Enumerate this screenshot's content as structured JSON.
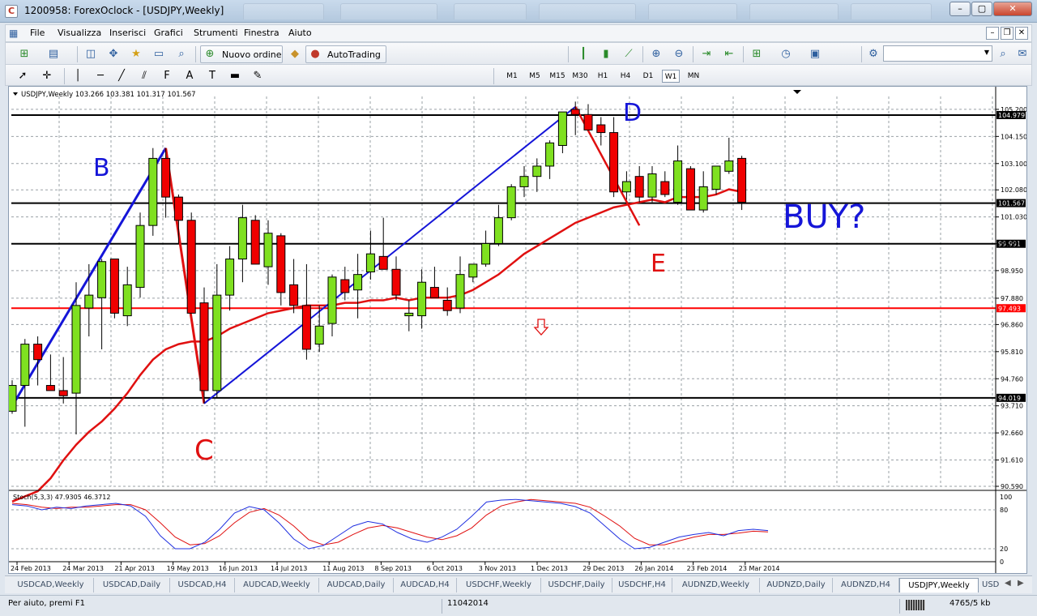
{
  "window": {
    "title": "1200958: ForexOclock - [USDJPY,Weekly]"
  },
  "menu": [
    "File",
    "Visualizza",
    "Inserisci",
    "Grafici",
    "Strumenti",
    "Finestra",
    "Aiuto"
  ],
  "toolbar": {
    "new_order_label": "Nuovo ordine",
    "autotrading_label": "AutoTrading",
    "search_value": ""
  },
  "timeframes": [
    "M1",
    "M5",
    "M15",
    "M30",
    "H1",
    "H4",
    "D1",
    "W1",
    "MN"
  ],
  "active_timeframe": "W1",
  "chart_data": {
    "type": "candlestick",
    "symbol_header": "USDJPY,Weekly  103.266 103.381 101.317 101.567",
    "y_range": [
      90.59,
      105.7
    ],
    "y_ticks": [
      "105.200",
      "104.150",
      "103.100",
      "102.080",
      "101.030",
      "99.991",
      "98.950",
      "97.880",
      "96.860",
      "95.810",
      "94.760",
      "93.710",
      "92.660",
      "91.610",
      "90.590"
    ],
    "x_labels": [
      "24 Feb 2013",
      "24 Mar 2013",
      "21 Apr 2013",
      "19 May 2013",
      "16 Jun 2013",
      "14 Jul 2013",
      "11 Aug 2013",
      "8 Sep 2013",
      "6 Oct 2013",
      "3 Nov 2013",
      "1 Dec 2013",
      "29 Dec 2013",
      "26 Jan 2014",
      "23 Feb 2014",
      "23 Mar 2014"
    ],
    "candles": [
      [
        93.5,
        94.7,
        93.4,
        94.5
      ],
      [
        94.5,
        96.3,
        92.9,
        96.1
      ],
      [
        96.1,
        96.4,
        94.5,
        95.5
      ],
      [
        94.5,
        95.7,
        94.4,
        94.3
      ],
      [
        94.3,
        95.6,
        93.8,
        94.1
      ],
      [
        94.2,
        98.5,
        92.6,
        97.6
      ],
      [
        97.5,
        99.2,
        96.4,
        98.0
      ],
      [
        97.9,
        99.4,
        95.9,
        99.3
      ],
      [
        99.4,
        99.4,
        97.1,
        97.3
      ],
      [
        97.2,
        99.1,
        96.8,
        98.4
      ],
      [
        98.3,
        101.2,
        97.9,
        100.7
      ],
      [
        100.7,
        103.7,
        100.3,
        103.3
      ],
      [
        103.3,
        103.7,
        101.0,
        101.8
      ],
      [
        101.8,
        101.9,
        100.0,
        100.9
      ],
      [
        100.9,
        101.2,
        97.5,
        97.3
      ],
      [
        97.7,
        98.3,
        93.8,
        94.3
      ],
      [
        94.3,
        99.2,
        94.0,
        98.0
      ],
      [
        98.0,
        99.9,
        97.4,
        99.4
      ],
      [
        99.4,
        101.5,
        98.5,
        101.0
      ],
      [
        100.9,
        101.1,
        99.4,
        99.2
      ],
      [
        99.1,
        100.9,
        98.4,
        100.4
      ],
      [
        100.3,
        100.4,
        97.6,
        98.1
      ],
      [
        98.4,
        99.4,
        97.3,
        97.6
      ],
      [
        97.6,
        99.2,
        95.5,
        95.9
      ],
      [
        96.1,
        97.6,
        95.8,
        96.8
      ],
      [
        96.9,
        98.8,
        96.4,
        98.7
      ],
      [
        98.6,
        99.1,
        97.8,
        98.1
      ],
      [
        98.2,
        99.6,
        97.1,
        98.8
      ],
      [
        98.9,
        100.5,
        98.6,
        99.6
      ],
      [
        99.5,
        101.0,
        99.4,
        99.0
      ],
      [
        99.0,
        99.5,
        97.8,
        98.0
      ],
      [
        97.2,
        97.8,
        96.6,
        97.3
      ],
      [
        97.2,
        99.0,
        96.7,
        98.5
      ],
      [
        98.3,
        99.1,
        97.9,
        97.9
      ],
      [
        97.8,
        98.3,
        97.2,
        97.4
      ],
      [
        97.5,
        99.5,
        97.3,
        98.8
      ],
      [
        98.7,
        99.2,
        98.5,
        99.2
      ],
      [
        99.2,
        100.5,
        99.1,
        100.0
      ],
      [
        100.0,
        101.5,
        99.9,
        101.0
      ],
      [
        101.0,
        102.3,
        100.9,
        102.2
      ],
      [
        102.2,
        103.0,
        101.8,
        102.6
      ],
      [
        102.6,
        103.3,
        102.0,
        103.0
      ],
      [
        103.0,
        104.0,
        102.5,
        103.9
      ],
      [
        103.8,
        105.0,
        103.5,
        105.1
      ],
      [
        105.2,
        105.5,
        104.2,
        105.0
      ],
      [
        105.0,
        105.4,
        104.4,
        104.4
      ],
      [
        104.6,
        104.9,
        103.8,
        104.3
      ],
      [
        104.3,
        104.9,
        101.8,
        102.0
      ],
      [
        102.0,
        102.8,
        101.7,
        102.4
      ],
      [
        102.6,
        103.0,
        101.6,
        101.8
      ],
      [
        101.8,
        103.0,
        101.6,
        102.7
      ],
      [
        102.4,
        102.8,
        101.8,
        101.9
      ],
      [
        101.6,
        103.8,
        101.5,
        103.2
      ],
      [
        102.9,
        103.0,
        101.3,
        101.3
      ],
      [
        101.3,
        102.8,
        101.2,
        102.2
      ],
      [
        102.1,
        102.9,
        101.9,
        103.0
      ],
      [
        102.8,
        104.1,
        102.7,
        103.2
      ],
      [
        103.3,
        103.4,
        101.3,
        101.6
      ]
    ],
    "ma_points": [
      90.0,
      90.2,
      90.4,
      90.9,
      91.6,
      92.2,
      92.7,
      93.1,
      93.6,
      94.2,
      94.9,
      95.5,
      95.9,
      96.1,
      96.2,
      96.2,
      96.4,
      96.7,
      96.9,
      97.1,
      97.3,
      97.4,
      97.5,
      97.6,
      97.6,
      97.6,
      97.7,
      97.7,
      97.8,
      97.8,
      97.9,
      97.8,
      97.9,
      97.9,
      97.9,
      98.0,
      98.2,
      98.5,
      98.8,
      99.2,
      99.6,
      99.9,
      100.2,
      100.5,
      100.8,
      101.0,
      101.2,
      101.4,
      101.5,
      101.6,
      101.7,
      101.6,
      101.8,
      101.8,
      101.8,
      101.9,
      102.1,
      102.0
    ],
    "h_lines": [
      {
        "price": 104.979,
        "label": "104.979",
        "color": "#000000"
      },
      {
        "price": 101.567,
        "label": "101.567",
        "color": "#000000"
      },
      {
        "price": 99.991,
        "label": "99.991",
        "color": "#000000"
      },
      {
        "price": 97.493,
        "label": "97.493",
        "color": "#ff0000"
      },
      {
        "price": 94.019,
        "label": "94.019",
        "color": "#000000"
      }
    ],
    "annotations": [
      {
        "text": "B",
        "color": "#1515d8"
      },
      {
        "text": "C",
        "color": "#e01010"
      },
      {
        "text": "D",
        "color": "#1515d8"
      },
      {
        "text": "E",
        "color": "#e01010"
      },
      {
        "text": "BUY?",
        "color": "#1515d8"
      }
    ],
    "stoch": {
      "label": "Stoch(5,3,3) 47.9305 46.3712",
      "y_ticks": [
        "100",
        "80",
        "20",
        "0"
      ],
      "main": [
        88,
        86,
        80,
        84,
        82,
        86,
        88,
        90,
        86,
        70,
        40,
        20,
        20,
        30,
        50,
        75,
        85,
        80,
        60,
        35,
        20,
        25,
        40,
        55,
        62,
        58,
        45,
        35,
        30,
        38,
        50,
        70,
        92,
        95,
        96,
        94,
        92,
        90,
        85,
        75,
        55,
        35,
        20,
        22,
        30,
        38,
        42,
        45,
        40,
        48,
        50,
        48
      ],
      "signal": [
        90,
        88,
        84,
        82,
        84,
        84,
        86,
        88,
        88,
        80,
        60,
        38,
        26,
        28,
        40,
        60,
        76,
        82,
        72,
        55,
        34,
        26,
        30,
        42,
        52,
        56,
        52,
        45,
        38,
        34,
        40,
        52,
        72,
        86,
        92,
        96,
        94,
        92,
        90,
        84,
        70,
        55,
        36,
        26,
        26,
        32,
        38,
        42,
        42,
        44,
        47,
        46
      ]
    },
    "colors": {
      "bull": "#7fe020",
      "bear": "#f00000",
      "ma": "#e01010",
      "stoch_main": "#2030e0",
      "stoch_signal": "#e01010",
      "abcd_blue": "#1515d8",
      "abcd_red": "#e01010"
    }
  },
  "symbol_tabs": [
    "USDCAD,Weekly",
    "USDCAD,Daily",
    "USDCAD,H4",
    "AUDCAD,Weekly",
    "AUDCAD,Daily",
    "AUDCAD,H4",
    "USDCHF,Weekly",
    "USDCHF,Daily",
    "USDCHF,H4",
    "AUDNZD,Weekly",
    "AUDNZD,Daily",
    "AUDNZD,H4",
    "USDJPY,Weekly",
    "USD"
  ],
  "active_symbol_tab": "USDJPY,Weekly",
  "status": {
    "help": "Per aiuto, premi F1",
    "code": "11042014",
    "traffic": "4765/5 kb"
  }
}
